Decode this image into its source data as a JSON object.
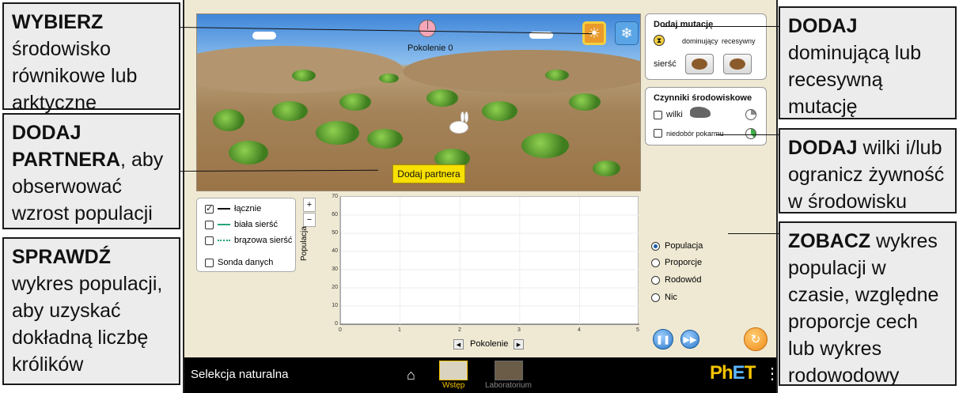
{
  "callouts": {
    "c1": {
      "strong": "WYBIERZ",
      "rest": "środowisko równikowe lub arktyczne"
    },
    "c2": {
      "strong1": "DODAJ",
      "strong2": "PARTNERA",
      "rest": ", aby obserwować wzrost populacji"
    },
    "c3": {
      "strong": "SPRAWDŹ",
      "rest": "wykres populacji, aby uzyskać dokładną liczbę królików"
    },
    "c4": {
      "strong": "DODAJ",
      "rest": "dominującą lub recesywną mutację"
    },
    "c5": {
      "strong": "DODAJ",
      "rest": " wilki i/lub ogranicz żywność w środowisku"
    },
    "c6": {
      "strong": "ZOBACZ",
      "rest": " wykres populacji w czasie, względne proporcje cech lub wykres rodowodowy"
    }
  },
  "scene": {
    "generation_label": "Pokolenie 0",
    "add_mate_label": "Dodaj partnera",
    "env_equator_icon": "sun-icon",
    "env_arctic_icon": "snowflake-icon"
  },
  "mutation_panel": {
    "title": "Dodaj mutację",
    "dominant": "dominujący",
    "recessive": "recesywny",
    "trait": "sierść"
  },
  "env_panel": {
    "title": "Czynniki środowiskowe",
    "wolves": "wilki",
    "food": "niedobór pokarmu"
  },
  "legend": {
    "total": "łącznie",
    "white": "biała sierść",
    "brown": "brązowa sierść",
    "probe": "Sonda danych",
    "zoom_in": "+",
    "zoom_out": "−"
  },
  "graph": {
    "y_label": "Populacja",
    "x_label": "Pokolenie",
    "y_ticks": [
      "70",
      "60",
      "50",
      "40",
      "30",
      "20",
      "10",
      "0"
    ],
    "x_ticks": [
      "0",
      "1",
      "2",
      "3",
      "4",
      "5"
    ]
  },
  "views": {
    "population": "Populacja",
    "proportions": "Proporcje",
    "pedigree": "Rodowód",
    "none": "Nic"
  },
  "navbar": {
    "title": "Selekcja naturalna",
    "screen1": "Wstęp",
    "screen2": "Laboratorium",
    "brand": "PhET"
  },
  "colors": {
    "total_line": "#111111",
    "white_line": "#27a37c",
    "brown_line": "#27a37c",
    "active_screen": "#f5c400"
  }
}
